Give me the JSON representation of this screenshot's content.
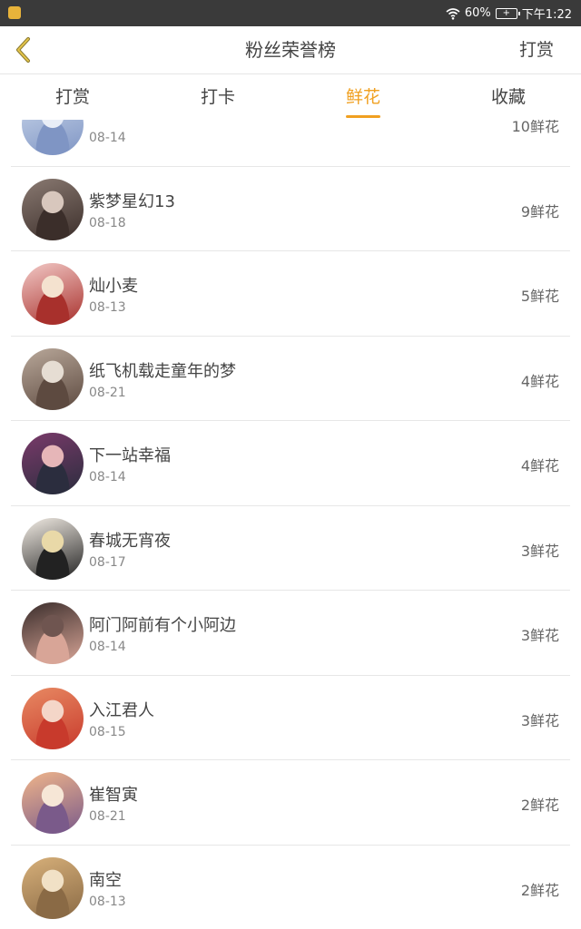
{
  "status_bar": {
    "battery_percent": "60%",
    "time": "下午1:22"
  },
  "header": {
    "title": "粉丝荣誉榜",
    "action_label": "打赏"
  },
  "tabs": [
    {
      "label": "打赏",
      "active": false
    },
    {
      "label": "打卡",
      "active": false
    },
    {
      "label": "鲜花",
      "active": true
    },
    {
      "label": "收藏",
      "active": false
    }
  ],
  "list": [
    {
      "name": "",
      "date": "08-14",
      "count": "10鲜花",
      "avatar_colors": [
        "#c9d6ea",
        "#7f95c4",
        "#e9eef7"
      ]
    },
    {
      "name": "紫梦星幻13",
      "date": "08-18",
      "count": "9鲜花",
      "avatar_colors": [
        "#8a7a72",
        "#3b2e2a",
        "#d8c7bd"
      ]
    },
    {
      "name": "灿小麦",
      "date": "08-13",
      "count": "5鲜花",
      "avatar_colors": [
        "#f2c9c6",
        "#a8302c",
        "#f4e2cf"
      ]
    },
    {
      "name": "纸飞机载走童年的梦",
      "date": "08-21",
      "count": "4鲜花",
      "avatar_colors": [
        "#b9a89a",
        "#5d4a40",
        "#e6ddd3"
      ]
    },
    {
      "name": "下一站幸福",
      "date": "08-14",
      "count": "4鲜花",
      "avatar_colors": [
        "#7a3a6a",
        "#2b2d3e",
        "#e6b6b8"
      ]
    },
    {
      "name": "春城无宵夜",
      "date": "08-17",
      "count": "3鲜花",
      "avatar_colors": [
        "#f3ede5",
        "#222222",
        "#e9d9a8"
      ]
    },
    {
      "name": "阿门阿前有个小阿边",
      "date": "08-14",
      "count": "3鲜花",
      "avatar_colors": [
        "#3a2d2b",
        "#d8a597",
        "#6f5550"
      ]
    },
    {
      "name": "入江君人",
      "date": "08-15",
      "count": "3鲜花",
      "avatar_colors": [
        "#e88a63",
        "#c83a2c",
        "#f4d6c8"
      ]
    },
    {
      "name": "崔智寅",
      "date": "08-21",
      "count": "2鲜花",
      "avatar_colors": [
        "#f0b58a",
        "#7a5a8a",
        "#f6e6d6"
      ]
    },
    {
      "name": "南空",
      "date": "08-13",
      "count": "2鲜花",
      "avatar_colors": [
        "#d7b07a",
        "#8a6a45",
        "#f1e1c6"
      ]
    }
  ],
  "colors": {
    "accent": "#f0a020",
    "back_icon": "#b8860b",
    "status_bg": "#3a3a3a"
  },
  "icons": {
    "back": "chevron-left-icon",
    "wifi": "wifi-icon",
    "battery": "battery-icon"
  }
}
